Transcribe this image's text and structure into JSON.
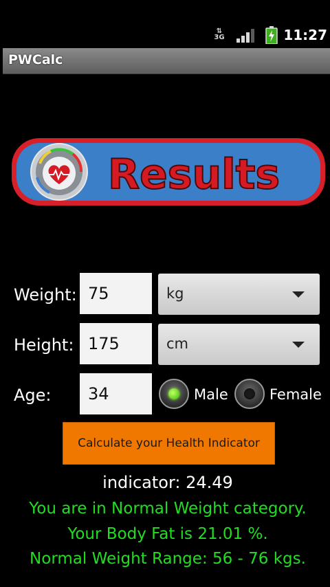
{
  "status_bar": {
    "network": "3G",
    "signal_icon": "signal-bars-icon",
    "battery_icon": "battery-charging-icon",
    "time": "11:27"
  },
  "app": {
    "title": "PWCalc"
  },
  "banner": {
    "text": "Results",
    "icon": "heart-gauge-icon",
    "fill_color": "#3b7fc8",
    "border_color": "#d8202a",
    "text_color": "#d61a24"
  },
  "form": {
    "weight": {
      "label": "Weight:",
      "value": "75",
      "unit": "kg"
    },
    "height": {
      "label": "Height:",
      "value": "175",
      "unit": "cm"
    },
    "age": {
      "label": "Age:",
      "value": "34"
    },
    "gender": {
      "options": [
        "Male",
        "Female"
      ],
      "selected": "Male"
    },
    "calculate_label": "Calculate your Health Indicator"
  },
  "results": {
    "indicator": "indicator: 24.49",
    "category": "You are in Normal Weight category.",
    "body_fat": "Your Body Fat is 21.01 %.",
    "range": "Normal Weight Range: 56 - 76 kgs."
  },
  "colors": {
    "button": "#f07800",
    "result_text": "#22dd22",
    "radio_selected": "#5fd01b"
  }
}
